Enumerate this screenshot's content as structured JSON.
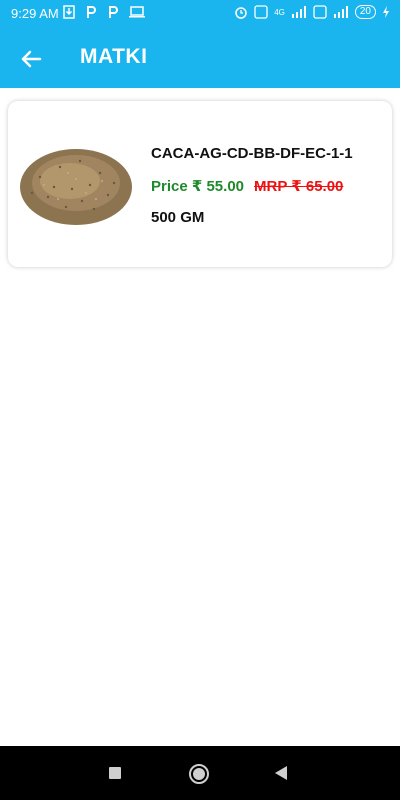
{
  "status_bar": {
    "time": "9:29 AM",
    "network_label": "4G",
    "battery": "20"
  },
  "app_bar": {
    "title": "MATKI",
    "back_icon": "arrow-left-icon"
  },
  "product": {
    "name": "CACA-AG-CD-BB-DF-EC-1-1",
    "price": "Price ₹ 55.00",
    "mrp": "MRP ₹ 65.00",
    "weight": "500 GM",
    "image_icon": "matki-seeds-image"
  },
  "nav": {
    "recents": "square-icon",
    "home": "circle-icon",
    "back": "triangle-back-icon"
  },
  "colors": {
    "header": "#1ab5ef",
    "price_green": "#1f8a2a",
    "mrp_red": "#e11111"
  }
}
